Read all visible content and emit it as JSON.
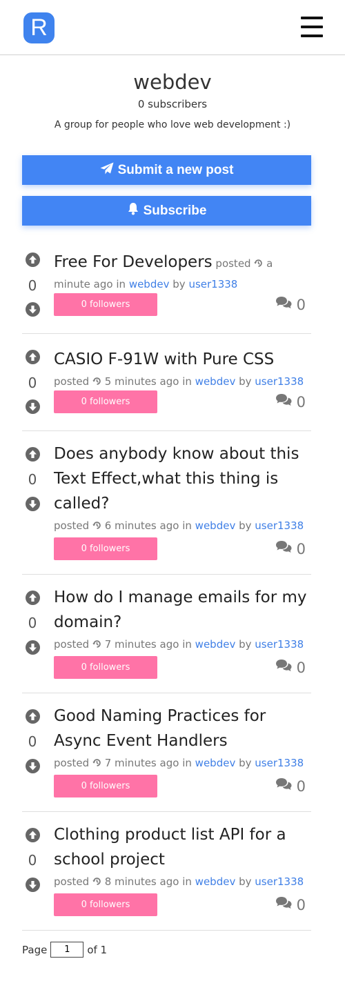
{
  "app": {
    "logo_letter": "R"
  },
  "group": {
    "name": "webdev",
    "subscribers": "0 subscribers",
    "description": "A group for people who love web development :)"
  },
  "actions": {
    "submit_label": "Submit a new post",
    "subscribe_label": "Subscribe"
  },
  "colors": {
    "primary": "#4285f4",
    "followers_button": "#ff73a7",
    "link": "#3f7fe6",
    "vote_icon": "#666666"
  },
  "icons": {
    "submit": "paper-plane-icon",
    "subscribe": "bell-icon",
    "upvote": "arrow-circle-up-icon",
    "downvote": "arrow-circle-down-icon",
    "time": "history-clock-icon",
    "comments": "comments-icon",
    "menu": "hamburger-menu-icon"
  },
  "posts": [
    {
      "title": "Free For Developers",
      "posted": "posted",
      "time": "a minute ago",
      "in": "in",
      "group": "webdev",
      "by": "by",
      "user": "user1338",
      "votes": "0",
      "followers": "0 followers",
      "comments": "0"
    },
    {
      "title": "CASIO F-91W with Pure CSS",
      "posted": "posted",
      "time": "5 minutes ago",
      "in": "in",
      "group": "webdev",
      "by": "by",
      "user": "user1338",
      "votes": "0",
      "followers": "0 followers",
      "comments": "0"
    },
    {
      "title": "Does anybody know about this Text Effect,what this thing is called?",
      "posted": "posted",
      "time": "6 minutes ago",
      "in": "in",
      "group": "webdev",
      "by": "by",
      "user": "user1338",
      "votes": "0",
      "followers": "0 followers",
      "comments": "0"
    },
    {
      "title": "How do I manage emails for my domain?",
      "posted": "posted",
      "time": "7 minutes ago",
      "in": "in",
      "group": "webdev",
      "by": "by",
      "user": "user1338",
      "votes": "0",
      "followers": "0 followers",
      "comments": "0"
    },
    {
      "title": "Good Naming Practices for Async Event Handlers",
      "posted": "posted",
      "time": "7 minutes ago",
      "in": "in",
      "group": "webdev",
      "by": "by",
      "user": "user1338",
      "votes": "0",
      "followers": "0 followers",
      "comments": "0"
    },
    {
      "title": "Clothing product list API for a school project",
      "posted": "posted",
      "time": "8 minutes ago",
      "in": "in",
      "group": "webdev",
      "by": "by",
      "user": "user1338",
      "votes": "0",
      "followers": "0 followers",
      "comments": "0"
    }
  ],
  "pagination": {
    "page_label": "Page",
    "current_page": "1",
    "of_label": "of 1"
  }
}
